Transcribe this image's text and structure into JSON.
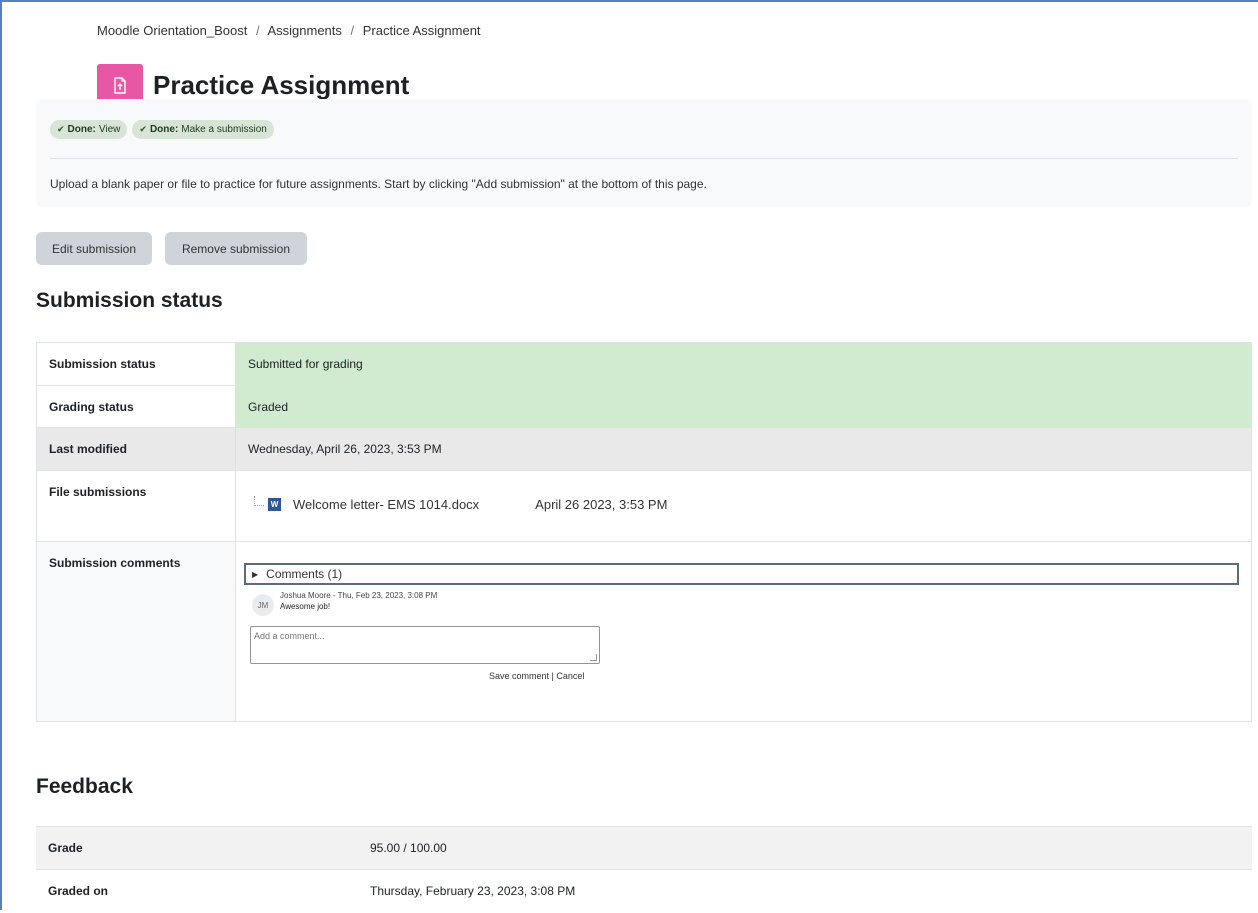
{
  "breadcrumb": [
    "Moodle Orientation_Boost",
    "Assignments",
    "Practice Assignment"
  ],
  "breadcrumb_separator": "/",
  "page": {
    "title": "Practice Assignment",
    "icon": "assignment-icon",
    "icon_color": "#e857a3"
  },
  "completion": [
    {
      "label": "Done:",
      "text": "View"
    },
    {
      "label": "Done:",
      "text": "Make a submission"
    }
  ],
  "intro": "Upload a blank paper or file to practice for future assignments. Start by clicking \"Add submission\" at the bottom of this page.",
  "actions": {
    "edit": "Edit submission",
    "remove": "Remove submission"
  },
  "submission": {
    "heading": "Submission status",
    "rows": {
      "status": {
        "label": "Submission status",
        "value": "Submitted for grading"
      },
      "grading": {
        "label": "Grading status",
        "value": "Graded"
      },
      "modified": {
        "label": "Last modified",
        "value": "Wednesday, April 26, 2023, 3:53 PM"
      },
      "files": {
        "label": "File submissions",
        "file_name": "Welcome letter- EMS 1014.docx",
        "file_date": "April 26 2023, 3:53 PM"
      },
      "comments": {
        "label": "Submission comments"
      }
    },
    "status_color": "#d0ebcf"
  },
  "comments": {
    "toggle": "Comments (1)",
    "items": [
      {
        "initials": "JM",
        "meta": "Joshua Moore - Thu, Feb 23, 2023, 3:08 PM",
        "text": "Awesome job!"
      }
    ],
    "placeholder": "Add a comment...",
    "save": "Save comment",
    "separator": "|",
    "cancel": "Cancel"
  },
  "feedback": {
    "heading": "Feedback",
    "rows": {
      "grade": {
        "label": "Grade",
        "value": "95.00 / 100.00"
      },
      "graded_on": {
        "label": "Graded on",
        "value": "Thursday, February 23, 2023, 3:08 PM"
      }
    }
  }
}
